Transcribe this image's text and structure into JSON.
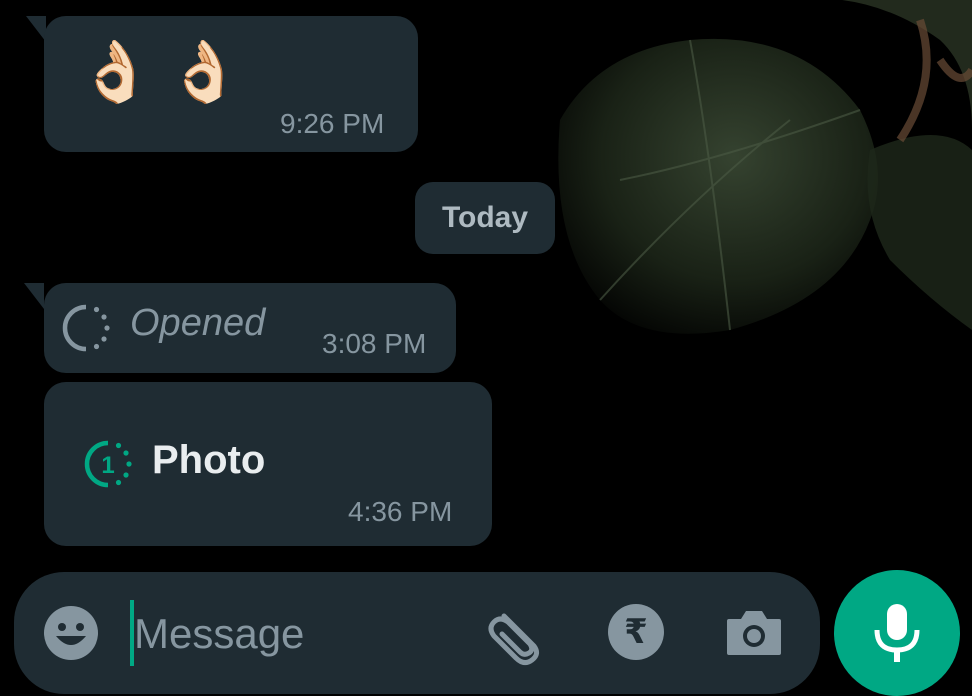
{
  "messages": [
    {
      "id": "msg-1",
      "content": "👌🏻👌🏻",
      "time": "9:26 PM"
    },
    {
      "id": "msg-2",
      "content": "Opened",
      "time": "3:08 PM"
    },
    {
      "id": "msg-3",
      "content": "Photo",
      "time": "4:36 PM",
      "view_once_count": "1"
    }
  ],
  "date_divider": "Today",
  "composer": {
    "placeholder": "Message",
    "icons": [
      "emoji-icon",
      "attach-icon",
      "rupee-payment-icon",
      "camera-icon",
      "mic-icon"
    ]
  },
  "colors": {
    "bubble": "#1f2c33",
    "accent": "#00a884",
    "muted_text": "#8696a0",
    "primary_text": "#e9edef",
    "background": "#000000"
  }
}
